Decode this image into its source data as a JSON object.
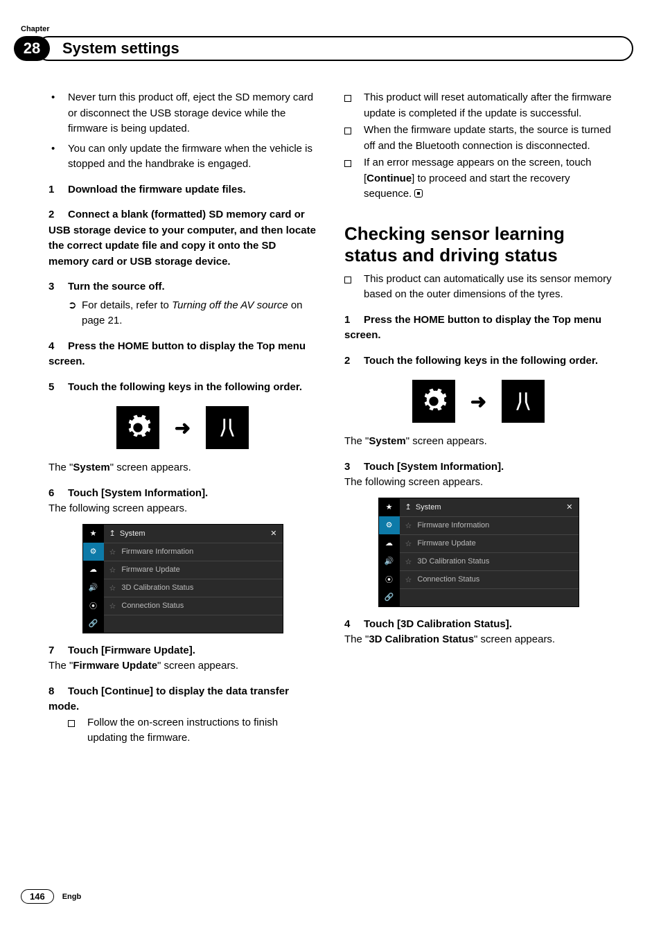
{
  "chapter_label": "Chapter",
  "chapter_number": "28",
  "chapter_title": "System settings",
  "page_number": "146",
  "lang": "Engb",
  "col1": {
    "bullets": [
      "Never turn this product off, eject the SD memory card or disconnect the USB storage device while the firmware is being updated.",
      "You can only update the firmware when the vehicle is stopped and the handbrake is engaged."
    ],
    "step1": {
      "num": "1",
      "text": "Download the firmware update files."
    },
    "step2": {
      "num": "2",
      "text": "Connect a blank (formatted) SD memory card or USB storage device to your computer, and then locate the correct update file and copy it onto the SD memory card or USB storage device."
    },
    "step3": {
      "num": "3",
      "text": "Turn the source off."
    },
    "step3_sub_prefix": "For details, refer to ",
    "step3_sub_italic": "Turning off the AV source",
    "step3_sub_suffix": " on page 21.",
    "step4": {
      "num": "4",
      "text": "Press the HOME button to display the Top menu screen."
    },
    "step5": {
      "num": "5",
      "text": "Touch the following keys in the following order."
    },
    "system_appears_prefix": "The \"",
    "system_appears_bold": "System",
    "system_appears_suffix": "\" screen appears.",
    "step6": {
      "num": "6",
      "text": "Touch [System Information]."
    },
    "step6_after": "The following screen appears.",
    "step7": {
      "num": "7",
      "text": "Touch [Firmware Update]."
    },
    "step7_after_prefix": "The \"",
    "step7_after_bold": "Firmware Update",
    "step7_after_suffix": "\" screen appears.",
    "step8": {
      "num": "8",
      "text": "Touch [Continue] to display the data transfer mode."
    },
    "step8_sub": "Follow the on-screen instructions to finish updating the firmware."
  },
  "col2": {
    "notes_a": [
      "This product will reset automatically after the firmware update is completed if the update is successful.",
      "When the firmware update starts, the source is turned off and the Bluetooth connection is disconnected."
    ],
    "note_continue_prefix": "If an error message appears on the screen, touch [",
    "note_continue_bold": "Continue",
    "note_continue_suffix": "] to proceed and start the recovery sequence.",
    "heading": "Checking sensor learning status and driving status",
    "heading_note": "This product can automatically use its sensor memory based on the outer dimensions of the tyres.",
    "step1": {
      "num": "1",
      "text": "Press the HOME button to display the Top menu screen."
    },
    "step2": {
      "num": "2",
      "text": "Touch the following keys in the following order."
    },
    "system_appears_prefix": "The \"",
    "system_appears_bold": "System",
    "system_appears_suffix": "\" screen appears.",
    "step3": {
      "num": "3",
      "text": "Touch [System Information]."
    },
    "step3_after": "The following screen appears.",
    "step4": {
      "num": "4",
      "text": "Touch [3D Calibration Status]."
    },
    "step4_after_prefix": "The \"",
    "step4_after_bold": "3D Calibration Status",
    "step4_after_suffix": "\" screen appears."
  },
  "screenshot": {
    "title": "System",
    "close": "✕",
    "back": "↥",
    "items": [
      "Firmware Information",
      "Firmware Update",
      "3D Calibration Status",
      "Connection Status"
    ],
    "side_icons": [
      "★",
      "⚙",
      "☁",
      "🔊",
      "⦿",
      "🔗"
    ]
  },
  "icons": {
    "gear": "gear-icon",
    "arrow": "➜",
    "wrench": "wrench-icon"
  }
}
